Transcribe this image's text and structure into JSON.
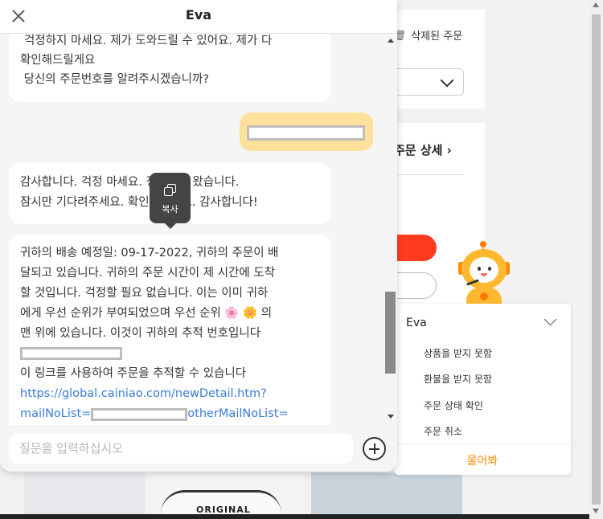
{
  "chat": {
    "title": "Eva",
    "messages": [
      {
        "from": "bot",
        "lines": [
          "걱정하지 마세요. 제가 도와드릴 수 있어요. 제가 다",
          "확인해드릴게요",
          " 당신의 주문번호를 알려주시겠습니까?"
        ]
      },
      {
        "from": "user",
        "redacted": true
      },
      {
        "from": "bot",
        "lines": [
          "감사합니다. 걱정 마세요. 정리하러 왔습니다.",
          "잠시만 기다려주세요. 확인드릴게요. 감사합니다!"
        ]
      },
      {
        "from": "bot",
        "lines": [
          "귀하의 배송 예정일: 09-17-2022, 귀하의 주문이 배",
          "달되고 있습니다. 귀하의 주문 시간이 제 시간에 도착",
          "할 것입니다. 걱정할 필요 없습니다. 이는 이미 귀하",
          "에게 우선 순위가 부여되었으며 우선 순위 🌸 🌼 의",
          "맨 위에 있습니다. 이것이 귀하의 추적 번호입니다"
        ],
        "link_intro": "이 링크를 사용하여 주문을 추적할 수 있습니다",
        "link_line1": "https://global.cainiao.com/newDetail.htm?",
        "link_line2_start": "mailNoList=",
        "link_line2_end": "otherMailNoList="
      }
    ],
    "copy_tooltip": "복사",
    "input_placeholder": "질문을 입력하십시오"
  },
  "background": {
    "deleted_orders": "삭제된 주문",
    "order_detail": "주문 상세",
    "product_label": "ORIGINAL"
  },
  "eva_menu": {
    "title": "Eva",
    "items": [
      "상품을 받지 못함",
      "환불을 받지 못함",
      "주문 상태 확인",
      "주문 취소"
    ],
    "ask_button": "물어봐"
  },
  "colors": {
    "user_bubble": "#ffe19b",
    "accent_orange": "#ff8a00",
    "link": "#3a7bd5",
    "red_button": "#ff3b1f"
  }
}
